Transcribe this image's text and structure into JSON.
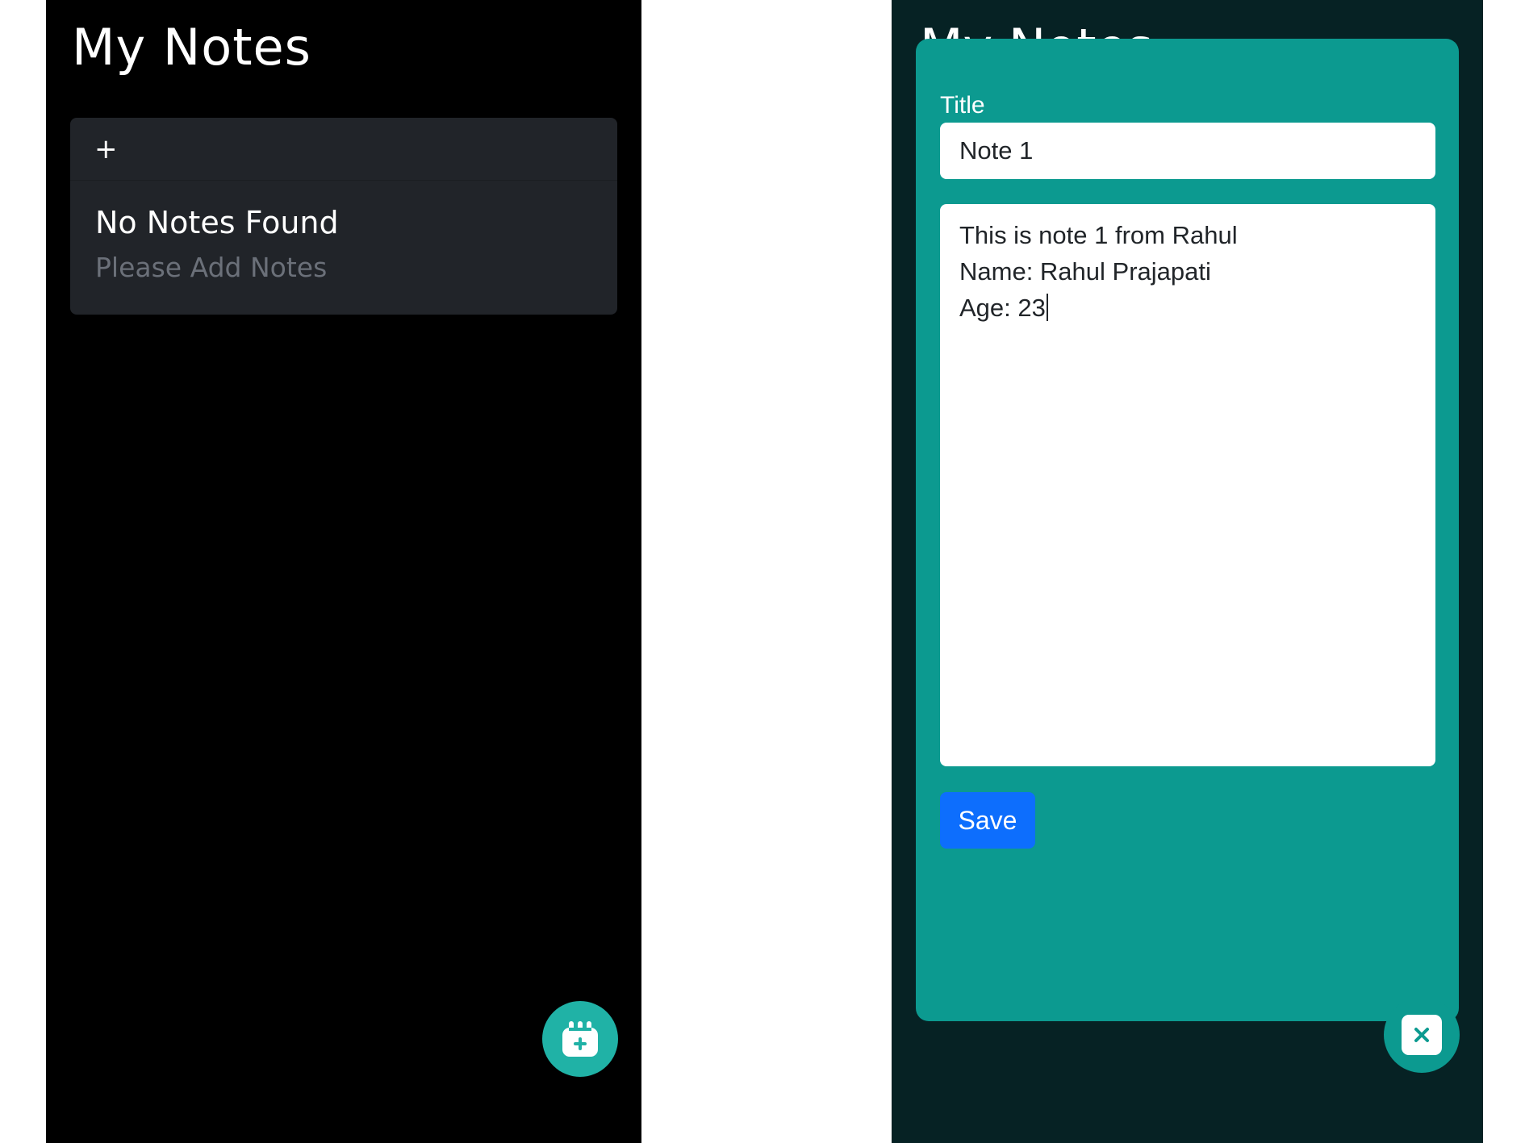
{
  "left_screen": {
    "app_title": "My Notes",
    "add_symbol": "+",
    "empty_state": {
      "title": "No Notes Found",
      "subtitle": "Please Add Notes"
    },
    "fab_icon": "calendar-plus-icon"
  },
  "right_screen": {
    "background_title": "My Notes",
    "modal": {
      "title_label": "Title",
      "title_value": "Note 1",
      "body_lines": [
        "This is note 1 from Rahul",
        "Name: Rahul Prajapati",
        "Age: 23"
      ],
      "save_label": "Save"
    },
    "fab_icon": "close-icon"
  },
  "colors": {
    "accent_teal": "#0c9a90",
    "fab_teal": "#20b2a6",
    "card_bg": "#212429",
    "save_blue": "#0d6efd",
    "right_bg": "#062224"
  }
}
